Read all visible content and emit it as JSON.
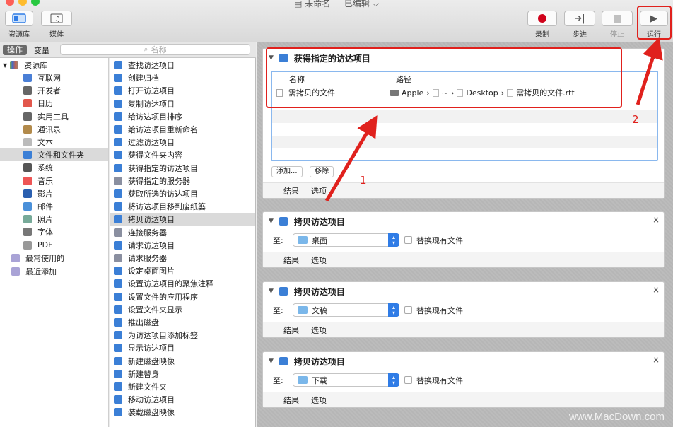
{
  "window": {
    "title": "未命名 — 已编辑"
  },
  "toolbar": {
    "library_label": "资源库",
    "media_label": "媒体",
    "record_label": "录制",
    "step_label": "步进",
    "stop_label": "停止",
    "run_label": "运行"
  },
  "sidebar_tabs": {
    "actions": "操作",
    "variables": "变量",
    "search_placeholder": "名称"
  },
  "library": {
    "root": "资源库",
    "items": [
      "互联网",
      "开发者",
      "日历",
      "实用工具",
      "通讯录",
      "文本",
      "文件和文件夹",
      "系统",
      "音乐",
      "影片",
      "邮件",
      "照片",
      "字体",
      "PDF"
    ],
    "smart": [
      "最常使用的",
      "最近添加"
    ]
  },
  "actions": [
    "查找访达项目",
    "创建归档",
    "打开访达项目",
    "复制访达项目",
    "给访达项目排序",
    "给访达项目重新命名",
    "过滤访达项目",
    "获得文件夹内容",
    "获得指定的访达项目",
    "获得指定的服务器",
    "获取所选的访达项目",
    "将访达项目移到废纸篓",
    "拷贝访达项目",
    "连接服务器",
    "请求访达项目",
    "请求服务器",
    "设定桌面图片",
    "设置访达项目的聚焦注释",
    "设置文件的应用程序",
    "设置文件夹显示",
    "推出磁盘",
    "为访达项目添加标签",
    "显示访达项目",
    "新建磁盘映像",
    "新建替身",
    "新建文件夹",
    "移动访达项目",
    "装载磁盘映像"
  ],
  "workflow": {
    "step1": {
      "title": "获得指定的访达项目",
      "col_name": "名称",
      "col_path": "路径",
      "file_name": "需拷贝的文件",
      "path": [
        "Apple",
        "~",
        "Desktop",
        "需拷贝的文件.rtf"
      ],
      "add": "添加...",
      "remove": "移除"
    },
    "copy_steps": [
      {
        "title": "拷贝访达项目",
        "to": "至:",
        "dest": "桌面",
        "replace": "替换现有文件"
      },
      {
        "title": "拷贝访达项目",
        "to": "至:",
        "dest": "文稿",
        "replace": "替换现有文件"
      },
      {
        "title": "拷贝访达项目",
        "to": "至:",
        "dest": "下载",
        "replace": "替换现有文件"
      }
    ],
    "results": "结果",
    "options": "选项"
  },
  "annotations": {
    "n1": "1",
    "n2": "2"
  },
  "watermark": "www.MacDown.com",
  "colors": {
    "accent": "#2f7ce6",
    "annotation_red": "#e0211d"
  }
}
